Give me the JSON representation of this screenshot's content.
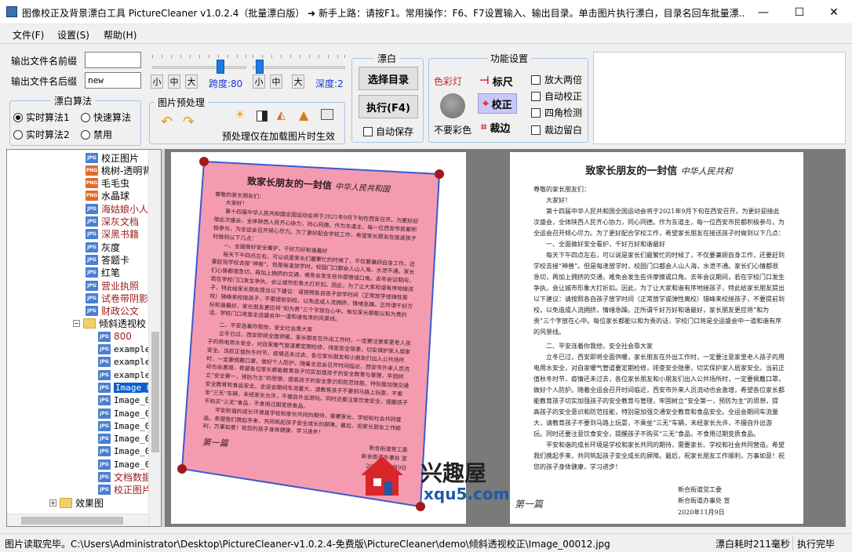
{
  "window": {
    "title": "图像校正及背景漂白工具 PictureCleaner v1.0.2.4（批量漂白版） ➜ 新手上路：请按F1。常用操作：F6、F7设置输入、输出目录。单击图片执行漂白，目录名回车批量漂...",
    "minimize": "—",
    "maximize": "☐",
    "close": "✕"
  },
  "menu": [
    "文件(F)",
    "设置(S)",
    "帮助(H)"
  ],
  "output": {
    "prefix_label": "输出文件名前缀",
    "prefix_value": "",
    "suffix_label": "输出文件名后缀",
    "suffix_value": "new"
  },
  "sliders": {
    "size_buttons": [
      "小",
      "中",
      "大"
    ],
    "span_label": "跨度:80",
    "depth_label": "深度:2",
    "span_value": 80,
    "depth_value": 2
  },
  "algo": {
    "title": "漂白算法",
    "options": [
      "实时算法1",
      "快速算法",
      "实时算法2",
      "禁用"
    ],
    "selected": "实时算法1"
  },
  "preprocess": {
    "title": "图片预处理",
    "note": "预处理仅在加载图片时生效"
  },
  "bleach": {
    "title": "漂白",
    "select_dir": "选择目录",
    "execute": "执行(F4)",
    "autosave": "自动保存"
  },
  "func": {
    "title": "功能设置",
    "color_lamp": "色彩灯",
    "no_color": "不要彩色",
    "ruler": "标尺",
    "correct": "校正",
    "crop": "裁边",
    "options": [
      "放大两倍",
      "自动校正",
      "四角检测",
      "裁边留白"
    ]
  },
  "tree": {
    "items": [
      {
        "icon": "JPG",
        "text": "校正图片",
        "style": ""
      },
      {
        "icon": "PNG",
        "text": "桃树-透明背",
        "style": ""
      },
      {
        "icon": "PNG",
        "text": "毛毛虫",
        "style": ""
      },
      {
        "icon": "PNG",
        "text": "水晶球",
        "style": ""
      },
      {
        "icon": "JPG",
        "text": "海姑娘小人",
        "style": "red"
      },
      {
        "icon": "JPG",
        "text": "深灰文档",
        "style": "red"
      },
      {
        "icon": "JPG",
        "text": "深黑书籍",
        "style": "red"
      },
      {
        "icon": "JPG",
        "text": "灰度",
        "style": ""
      },
      {
        "icon": "JPG",
        "text": "答题卡",
        "style": ""
      },
      {
        "icon": "JPG",
        "text": "红笔",
        "style": ""
      },
      {
        "icon": "JPG",
        "text": "营业执照",
        "style": "red"
      },
      {
        "icon": "JPG",
        "text": "试卷带阴影",
        "style": "red"
      },
      {
        "icon": "JPG",
        "text": "财政公文",
        "style": "red"
      },
      {
        "icon": "DIR",
        "text": "倾斜透视校",
        "style": ""
      },
      {
        "icon": "JPG",
        "text": "800",
        "style": "red"
      },
      {
        "icon": "JPG",
        "text": "example",
        "style": "mono"
      },
      {
        "icon": "JPG",
        "text": "example",
        "style": "mono"
      },
      {
        "icon": "JPG",
        "text": "example",
        "style": "mono"
      },
      {
        "icon": "JPG",
        "text": "Image_0",
        "style": "mono sel"
      },
      {
        "icon": "JPG",
        "text": "Image_0",
        "style": "mono"
      },
      {
        "icon": "JPG",
        "text": "Image_0",
        "style": "mono"
      },
      {
        "icon": "JPG",
        "text": "Image_0",
        "style": "mono"
      },
      {
        "icon": "JPG",
        "text": "Image_0",
        "style": "mono"
      },
      {
        "icon": "JPG",
        "text": "Image_0",
        "style": "mono"
      },
      {
        "icon": "JPG",
        "text": "Image_0",
        "style": "mono"
      },
      {
        "icon": "JPG",
        "text": "文档数据",
        "style": "red"
      },
      {
        "icon": "JPG",
        "text": "校正图片",
        "style": "red"
      },
      {
        "icon": "DIR",
        "text": "效果图",
        "style": ""
      }
    ]
  },
  "doc_left": {
    "title": "致家长朋友的一封信",
    "handwritten": "中华人民共和国",
    "salutation": "尊敬的家长朋友们：",
    "greeting": "大家好！",
    "para1": "第十四届中华人民共和国全国运动会将于2021年9月下旬在西安召开。为更好迎接此次盛会，全体陕西人民齐心协力，同心同德。作为东道主，每一位西安市民都积极参与，为全运会召开倾心尽力。为了更好配合学校工作，希望家长朋友在接送孩子时做到以下几点：",
    "h1": "一、全面做好安全看护，千好万好和谐最好",
    "para2": "每天下午四点左右，可以说是家长们最繁忙的时候了，不仅要兼顾自身工作，还要赶到学校去接“神兽”。但是每逢放学时，校园门口都会人山人海，水泄不通。家长们心情都很急切，再加上拥挤的交通，难免会发生些许摩擦或口角。去年会议期间，若在学校门口发生争执，会让城市形象大打折扣。因此，为了让大家和谐有序地接孩子，特此给家长朋友提出以下建议：请按照各自孩子放学时间（正常放学或弹性离校）错峰来校接孩子，不要提前到校，以免造成人流拥挤，情绪急躁。正所谓千好万好和谐最好，家长朋友更应将“和为贵”三个字放在心中。每位家长都能以和为贵的话，学校门口将是全运盛会中一道和谐有序的风景线。",
    "h2": "二、平安连着你我他，安全社会靠大家",
    "para3": "立冬已过，西安即将全面供暖，家长朋友在外出工作时，一定要注意家里老人孩子的用电用水安全，对自家暖气管道要定期检修，排查安全隐患，切实保护家人居家安全。当前正值秋冬时节，疫情还未过去，各位家长朋友和小朋友们出入公共场所时，一定要佩戴口罩，做好个人防护。随着全运会召开时间临近，西安市外来人员流动也会激增，希望各位家长都能教育孩子切实加强孩子的安全教育与管理，牢固树立“安全第一，预防为主”的思想，提高孩子的安全意识和防范技能，特别是加强交通安全教育和食品安全。全运会期间车流量大，请教育孩子不要到马路上玩耍，不乘坐“三无”车辆，未经家长允许，不擅自外出游玩。同时还要注意饮食安全，提醒孩子不购买“三无”食品，不食用过期变质食品。",
    "para4": "平安和谐的成长环境是学校和家长共同的期待，需要家长、学校和社会共同营造。希望我们携起手来，共同筑起孩子安全成长的屏障。最后，祝家长朋友工作顺利，万事如意！祝您的孩子身体健康，学习进步！",
    "sign_sig": "第一篇",
    "sign1": "新合街道党工委",
    "sign2": "新合街道办事处 宣",
    "sign3": "2020年11月9日"
  },
  "doc_right": {
    "title": "致家长朋友的一封信",
    "handwritten": "中华人民共和",
    "salutation": "尊敬的家长朋友们：",
    "greeting": "大家好！",
    "sign_sig": "第一篇",
    "sign1": "新合街道党工委",
    "sign2": "新合街道办事处 宣",
    "sign3": "2020年11月9日"
  },
  "watermark": {
    "brand": "兴趣屋",
    "url": "xqu5.com"
  },
  "status": {
    "message": "图片读取完毕。C:\\Users\\Administrator\\Desktop\\PictureCleaner-v1.0.2.4-免费版\\PictureCleaner\\demo\\倾斜透视校正\\Image_00012.jpg",
    "time": "漂白耗时211毫秒",
    "done": "执行完毕"
  }
}
